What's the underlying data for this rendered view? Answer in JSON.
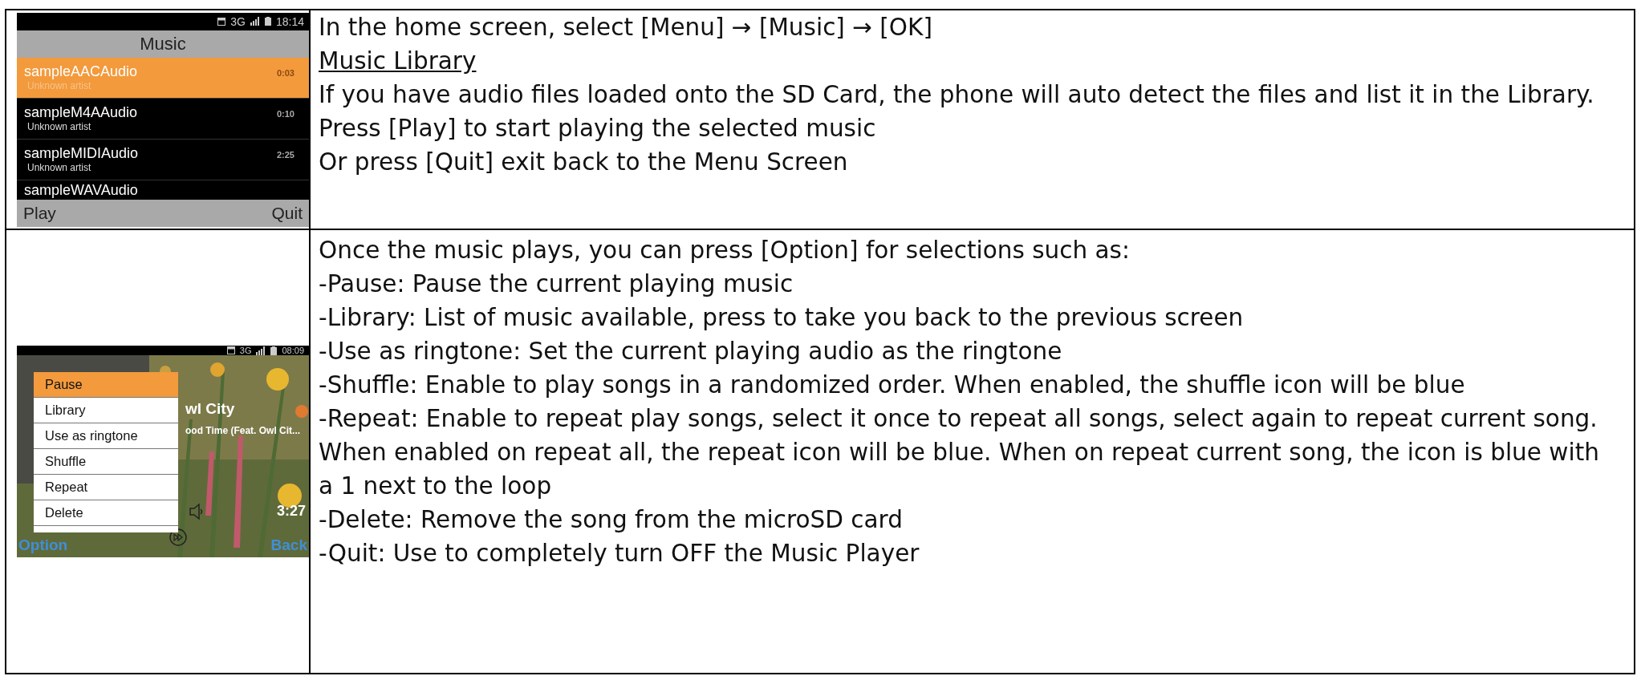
{
  "rows": [
    {
      "screen": {
        "kind": "list",
        "status": {
          "network": "3G",
          "time": "18:14"
        },
        "title": "Music",
        "tracks": [
          {
            "title": "sampleAACAudio",
            "artist": "Unknown artist",
            "duration": "0:03",
            "selected": true
          },
          {
            "title": "sampleM4AAudio",
            "artist": "Unknown artist",
            "duration": "0:10",
            "selected": false
          },
          {
            "title": "sampleMIDIAudio",
            "artist": "Unknown artist",
            "duration": "2:25",
            "selected": false
          }
        ],
        "partial_track": "sampleWAVAudio",
        "softkeys": [
          "Play",
          "Quit"
        ]
      },
      "lines": [
        {
          "kind": "text",
          "text": "In the home screen, select [Menu] → [Music] → [OK]"
        },
        {
          "kind": "heading",
          "text": "Music Library"
        },
        {
          "kind": "text",
          "text": "If you have audio files loaded onto the SD Card, the phone will auto detect the files and list it in the Library."
        },
        {
          "kind": "text",
          "text": "Press [Play] to start playing the selected music"
        },
        {
          "kind": "text",
          "text": "Or press [Quit] exit back to the Menu Screen"
        }
      ]
    },
    {
      "screen": {
        "kind": "player",
        "status": {
          "network": "3G",
          "time": "08:09"
        },
        "artist": "wl City",
        "song": "ood Time (Feat. Owl Cit...",
        "elapsed": "3:27",
        "menu": [
          {
            "label": "Pause",
            "selected": true
          },
          {
            "label": "Library",
            "selected": false
          },
          {
            "label": "Use as ringtone",
            "selected": false
          },
          {
            "label": "Shuffle",
            "selected": false
          },
          {
            "label": "Repeat",
            "selected": false
          },
          {
            "label": "Delete",
            "selected": false
          }
        ],
        "softkeys": [
          "Option",
          "Back"
        ]
      },
      "lines": [
        {
          "kind": "text",
          "text": "Once the music plays, you can press [Option] for selections such as:"
        },
        {
          "kind": "text",
          "text": "-Pause: Pause the current playing music"
        },
        {
          "kind": "text",
          "text": "-Library: List of music available, press to take you back to the previous screen"
        },
        {
          "kind": "text",
          "text": "-Use as ringtone: Set the current playing audio as the ringtone"
        },
        {
          "kind": "text",
          "text": "-Shuffle: Enable to play songs in a randomized order. When enabled, the shuffle icon will be blue"
        },
        {
          "kind": "text",
          "text": "-Repeat: Enable to repeat play songs, select it once to repeat all songs, select again to repeat current song."
        },
        {
          "kind": "text",
          "text": "When enabled on repeat all, the repeat icon will be blue. When on repeat current song, the icon is blue with"
        },
        {
          "kind": "text",
          "text": "a 1 next to the loop"
        },
        {
          "kind": "text",
          "text": "-Delete: Remove the song from the microSD card"
        },
        {
          "kind": "text",
          "text": "-Quit: Use to completely turn OFF the Music Player"
        }
      ]
    }
  ]
}
